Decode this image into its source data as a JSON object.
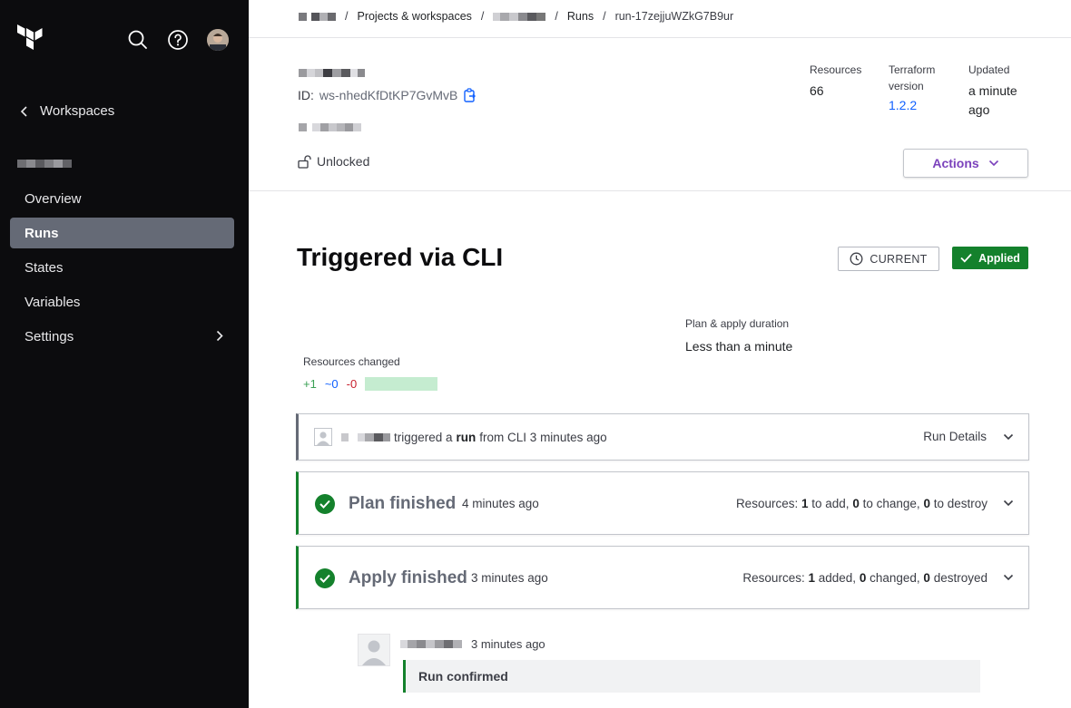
{
  "sidebar": {
    "logo": "terraform-logo",
    "icons": [
      "search-icon",
      "help-icon",
      "user-avatar"
    ],
    "back_label": "Workspaces",
    "items": [
      {
        "label": "Overview"
      },
      {
        "label": "Runs",
        "active": true
      },
      {
        "label": "States"
      },
      {
        "label": "Variables"
      },
      {
        "label": "Settings"
      }
    ]
  },
  "breadcrumb": {
    "projects": "Projects & workspaces",
    "runs": "Runs",
    "run_id": "run-17zejjuWZkG7B9ur",
    "separator": "/"
  },
  "workspace": {
    "id_label": "ID:",
    "id_value": "ws-nhedKfDtKP7GvMvB",
    "lock_status": "Unlocked"
  },
  "meta": {
    "resources_label": "Resources",
    "resources_value": "66",
    "tf_version_label_1": "Terraform",
    "tf_version_label_2": "version",
    "tf_version_value": "1.2.2",
    "updated_label": "Updated",
    "updated_value_1": "a minute",
    "updated_value_2": "ago"
  },
  "actions_label": "Actions",
  "run": {
    "title": "Triggered via CLI",
    "current_badge": "CURRENT",
    "status_badge": "Applied",
    "duration_label": "Plan & apply duration",
    "duration_value": "Less than a minute",
    "resources_changed_label": "Resources changed",
    "added": "+1",
    "changed": "~0",
    "destroyed": "-0"
  },
  "trigger": {
    "text_a": "triggered a",
    "text_run": "run",
    "text_b": "from CLI 3 minutes ago",
    "details_label": "Run Details"
  },
  "plan": {
    "title": "Plan finished",
    "time": "4 minutes ago",
    "res_prefix": "Resources:",
    "add_n": "1",
    "add_label": "to add,",
    "chg_n": "0",
    "chg_label": "to change,",
    "del_n": "0",
    "del_label": "to destroy"
  },
  "apply": {
    "title": "Apply finished",
    "time": "3 minutes ago",
    "res_prefix": "Resources:",
    "add_n": "1",
    "add_label": "added,",
    "chg_n": "0",
    "chg_label": "changed,",
    "del_n": "0",
    "del_label": "destroyed"
  },
  "confirmation": {
    "time": "3 minutes ago",
    "message": "Run confirmed"
  },
  "colors": {
    "sidebar_bg": "#0c0c0e",
    "active_nav": "#656a76",
    "success": "#14812c",
    "actions_purple": "#7b42bc",
    "link_blue": "#1060ff"
  }
}
